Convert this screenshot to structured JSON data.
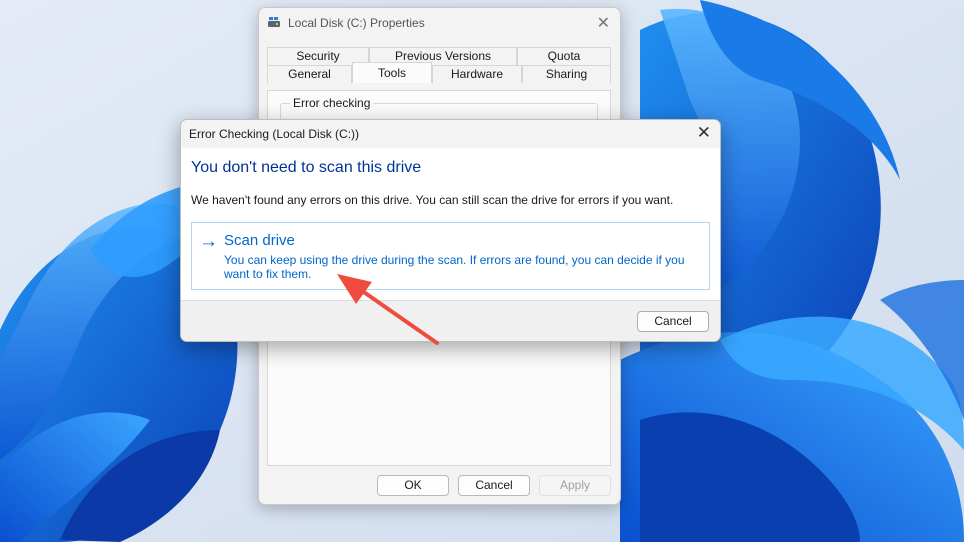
{
  "properties_window": {
    "title": "Local Disk (C:) Properties",
    "tabs_row1": [
      "Security",
      "Previous Versions",
      "Quota"
    ],
    "tabs_row2": [
      "General",
      "Tools",
      "Hardware",
      "Sharing"
    ],
    "active_tab": "Tools",
    "group_label": "Error checking",
    "buttons": {
      "ok": "OK",
      "cancel": "Cancel",
      "apply": "Apply"
    }
  },
  "error_dialog": {
    "title": "Error Checking (Local Disk (C:))",
    "heading": "You don't need to scan this drive",
    "body": "We haven't found any errors on this drive. You can still scan the drive for errors if you want.",
    "scan_link": {
      "arrow": "→",
      "title": "Scan drive",
      "description": "You can keep using the drive during the scan. If errors are found, you can decide if you want to fix them."
    },
    "cancel_label": "Cancel"
  },
  "icons": {
    "close": "close-icon",
    "drive": "drive-icon",
    "scan_arrow": "arrow-right-icon"
  },
  "colors": {
    "heading_blue": "#003399",
    "link_blue": "#0066cc",
    "annotation_red": "#ef4b3f",
    "wallpaper_bg": "#dde6f3"
  }
}
